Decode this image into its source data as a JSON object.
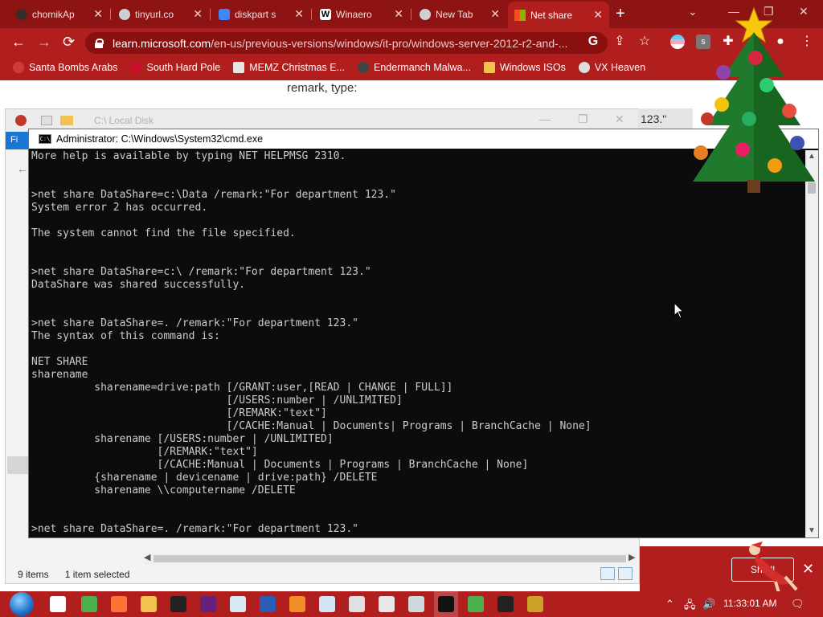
{
  "browser": {
    "tabs": [
      {
        "label": "chomikAp",
        "color": "#3a2a2a"
      },
      {
        "label": "tinyurl.co",
        "color": "#cfcfcf"
      },
      {
        "label": "diskpart s",
        "color": "#4285f4"
      },
      {
        "label": "Winaero",
        "color": "#ffffff"
      },
      {
        "label": "New Tab",
        "color": "#cfcfcf"
      },
      {
        "label": "Net share",
        "color": "#f25022"
      }
    ],
    "new_tab_glyph": "+",
    "window_controls": [
      "⌄",
      "—",
      "❐",
      "✕"
    ],
    "nav": {
      "back": "←",
      "forward": "→",
      "reload": "⟳"
    },
    "url_host": "learn.microsoft.com",
    "url_path": "/en-us/previous-versions/windows/it-pro/windows-server-2012-r2-and-...",
    "omni_icons": {
      "google": "G",
      "share": "⇪",
      "star": "☆",
      "ext_s": "s",
      "puzzle": "✚",
      "profile": "●",
      "menu": "⋮"
    },
    "bookmarks": [
      {
        "label": "Santa Bombs Arabs",
        "color": "#d13a3a"
      },
      {
        "label": "South Hard Pole",
        "color": "#c8102e"
      },
      {
        "label": "MEMZ Christmas E...",
        "color": "#e6e6e6"
      },
      {
        "label": "Endermanch Malwa...",
        "color": "#444444"
      },
      {
        "label": "Windows ISOs",
        "color": "#f2c14e"
      },
      {
        "label": "VX Heaven",
        "color": "#dddddd"
      }
    ],
    "page_text": "remark, type:",
    "right_snippet": "123.\""
  },
  "explorer": {
    "title": "C:\\ Local Disk",
    "ribbon_label": "Fi",
    "back_arrow": "←",
    "status_items": "9 items",
    "status_selected": "1 item selected",
    "controls": [
      "—",
      "❐",
      "✕"
    ],
    "scroll_left": "◀",
    "scroll_right": "▶"
  },
  "cmd": {
    "title": "Administrator: C:\\Windows\\System32\\cmd.exe",
    "icon_text": "C:\\",
    "lines": [
      "More help is available by typing NET HELPMSG 2310.",
      "",
      "",
      ">net share DataShare=c:\\Data /remark:\"For department 123.\"",
      "System error 2 has occurred.",
      "",
      "The system cannot find the file specified.",
      "",
      "",
      ">net share DataShare=c:\\ /remark:\"For department 123.\"",
      "DataShare was shared successfully.",
      "",
      "",
      ">net share DataShare=. /remark:\"For department 123.\"",
      "The syntax of this command is:",
      "",
      "NET SHARE",
      "sharename",
      "          sharename=drive:path [/GRANT:user,[READ | CHANGE | FULL]]",
      "                               [/USERS:number | /UNLIMITED]",
      "                               [/REMARK:\"text\"]",
      "                               [/CACHE:Manual | Documents| Programs | BranchCache | None]",
      "          sharename [/USERS:number | /UNLIMITED]",
      "                    [/REMARK:\"text\"]",
      "                    [/CACHE:Manual | Documents | Programs | BranchCache | None]",
      "          {sharename | devicename | drive:path} /DELETE",
      "          sharename \\\\computername /DELETE",
      "",
      "",
      ">net share DataShare=. /remark:\"For department 123.\""
    ],
    "scroll_up": "▲",
    "scroll_down": "▼"
  },
  "notification": {
    "label": "Sh...ll",
    "close": "✕"
  },
  "taskbar": {
    "apps": [
      {
        "name": "task-view",
        "color": "#ffffff"
      },
      {
        "name": "chrome",
        "color": "#4caf50"
      },
      {
        "name": "firefox",
        "color": "#ff7139"
      },
      {
        "name": "file-explorer",
        "color": "#f2c14e"
      },
      {
        "name": "7zip",
        "color": "#222222"
      },
      {
        "name": "visual-studio",
        "color": "#68217a"
      },
      {
        "name": "notepad",
        "color": "#dbe9f7"
      },
      {
        "name": "powershell",
        "color": "#2a5bb5"
      },
      {
        "name": "vlc",
        "color": "#f28c28"
      },
      {
        "name": "app-window",
        "color": "#d0e4f5"
      },
      {
        "name": "app-blank",
        "color": "#e0e0e0"
      },
      {
        "name": "app-printer",
        "color": "#e8e8e8"
      },
      {
        "name": "app-tools",
        "color": "#cfd8dc"
      },
      {
        "name": "cmd",
        "color": "#111111"
      },
      {
        "name": "app-green",
        "color": "#4caf50"
      },
      {
        "name": "xming",
        "color": "#222222"
      },
      {
        "name": "app-orb",
        "color": "#c9a227"
      }
    ],
    "tray_caret": "⌃",
    "tray_network": "🖧",
    "tray_volume": "🔊",
    "clock": "11:33:01 AM",
    "notifications": "🗨"
  }
}
